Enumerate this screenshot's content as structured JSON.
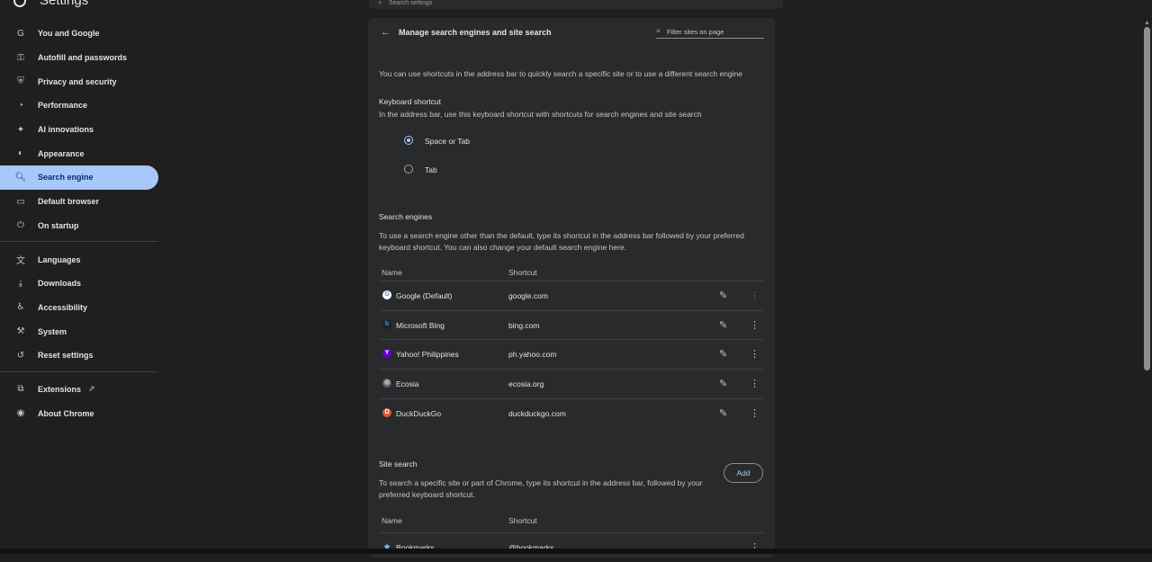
{
  "app": {
    "title": "Settings",
    "search_placeholder": "Search settings"
  },
  "sidebar": {
    "items": [
      {
        "label": "You and Google",
        "icon": "google-g-icon",
        "glyph": "G"
      },
      {
        "label": "Autofill and passwords",
        "icon": "key-icon",
        "glyph": "⚿"
      },
      {
        "label": "Privacy and security",
        "icon": "shield-icon",
        "glyph": "⛨"
      },
      {
        "label": "Performance",
        "icon": "speedometer-icon",
        "glyph": "◔"
      },
      {
        "label": "AI innovations",
        "icon": "sparkle-icon",
        "glyph": "✦"
      },
      {
        "label": "Appearance",
        "icon": "palette-icon",
        "glyph": "◐"
      },
      {
        "label": "Search engine",
        "icon": "search-icon",
        "glyph": "🔍︎",
        "active": true
      },
      {
        "label": "Default browser",
        "icon": "browser-window-icon",
        "glyph": "▭"
      },
      {
        "label": "On startup",
        "icon": "power-icon",
        "glyph": "⏻"
      },
      {
        "label": "Languages",
        "icon": "translate-icon",
        "glyph": "文"
      },
      {
        "label": "Downloads",
        "icon": "download-icon",
        "glyph": "⤓"
      },
      {
        "label": "Accessibility",
        "icon": "accessibility-icon",
        "glyph": "♿︎"
      },
      {
        "label": "System",
        "icon": "wrench-icon",
        "glyph": "⚒"
      },
      {
        "label": "Reset settings",
        "icon": "reset-icon",
        "glyph": "↺"
      },
      {
        "label": "Extensions",
        "icon": "puzzle-icon",
        "glyph": "⧉"
      },
      {
        "label": "About Chrome",
        "icon": "chrome-icon",
        "glyph": "◉"
      }
    ]
  },
  "main": {
    "title": "Manage search engines and site search",
    "filter_placeholder": "Filter sites on page",
    "intro": "You can use shortcuts in the address bar to quickly search a specific site or to use a different search engine",
    "keyboard": {
      "heading": "Keyboard shortcut",
      "desc": "In the address bar, use this keyboard shortcut with shortcuts for search engines and site search",
      "options": [
        {
          "label": "Space or Tab",
          "selected": true
        },
        {
          "label": "Tab",
          "selected": false
        }
      ]
    },
    "engines": {
      "heading": "Search engines",
      "desc1": "To use a search engine other than the default, type its shortcut in the address bar followed by your preferred",
      "desc2": "keyboard shortcut. You can also change your default search engine here.",
      "col_name": "Name",
      "col_shortcut": "Shortcut",
      "rows": [
        {
          "name": "Google (Default)",
          "shortcut": "google.com",
          "color": "#ffffff",
          "glyph": "G",
          "glyph_color": "#4285f4"
        },
        {
          "name": "Microsoft Bing",
          "shortcut": "bing.com",
          "color": "#1f1f1f",
          "glyph": "b",
          "glyph_color": "#3b9df8"
        },
        {
          "name": "Yahoo! Philippines",
          "shortcut": "ph.yahoo.com",
          "color": "#6001d2",
          "glyph": "Y",
          "glyph_color": "#ffffff"
        },
        {
          "name": "Ecosia",
          "shortcut": "ecosia.org",
          "color": "#5f6368",
          "glyph": "◍",
          "glyph_color": "#c4c7c5"
        },
        {
          "name": "DuckDuckGo",
          "shortcut": "duckduckgo.com",
          "color": "#de5833",
          "glyph": "D",
          "glyph_color": "#ffffff"
        }
      ]
    },
    "site_search": {
      "heading": "Site search",
      "add_label": "Add",
      "desc1": "To search a specific site or part of Chrome, type its shortcut in the address bar, followed by your",
      "desc2": "preferred keyboard shortcut.",
      "col_name": "Name",
      "col_shortcut": "Shortcut",
      "rows": [
        {
          "name": "Bookmarks",
          "shortcut": "@bookmarks"
        }
      ]
    }
  }
}
